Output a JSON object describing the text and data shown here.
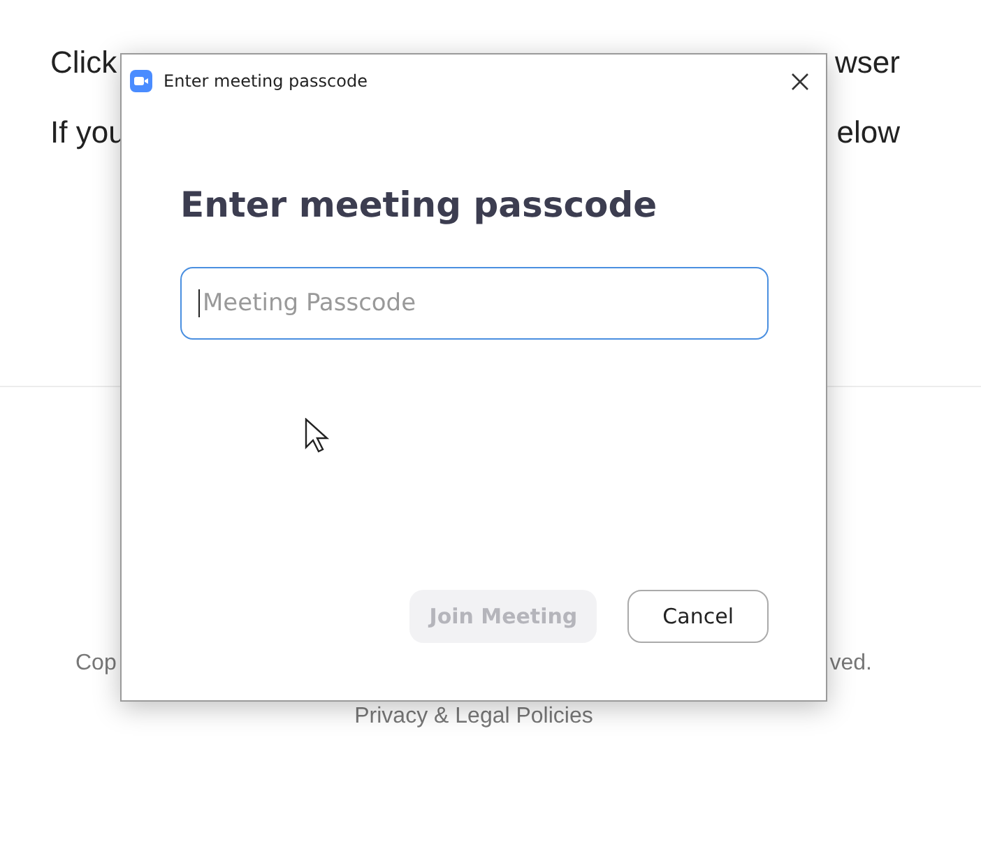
{
  "page": {
    "lines": [
      {
        "left": "Click",
        "right": "wser"
      },
      {
        "left": "If you",
        "right": "elow"
      }
    ],
    "footer": {
      "left": "Cop",
      "right": "ved."
    },
    "footer_link": "Privacy & Legal Policies"
  },
  "dialog": {
    "title": "Enter meeting passcode",
    "heading": "Enter meeting passcode",
    "field": {
      "placeholder": "Meeting Passcode",
      "focused": true
    },
    "buttons": [
      {
        "label": "Join Meeting",
        "kind": "primary",
        "disabled": true
      },
      {
        "label": "Cancel",
        "kind": "secondary",
        "disabled": false
      }
    ]
  }
}
